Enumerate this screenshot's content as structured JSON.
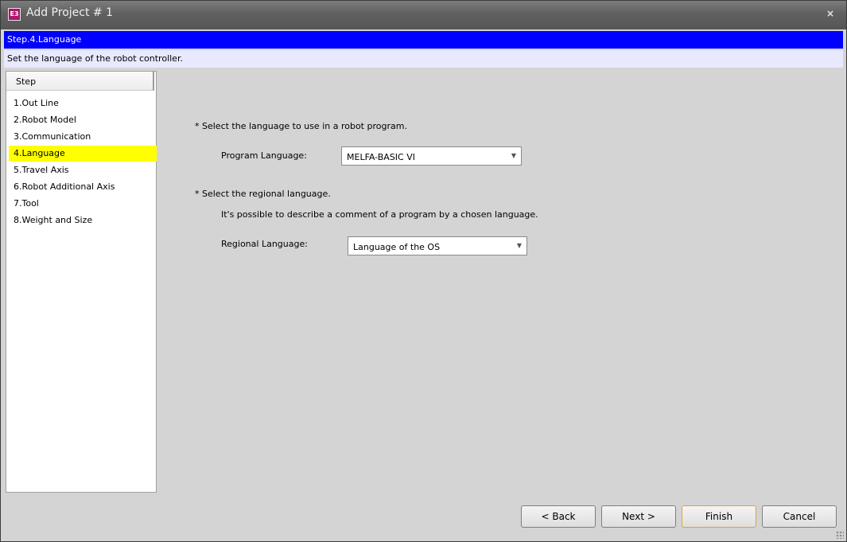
{
  "window": {
    "title": "Add Project # 1",
    "close_glyph": "×",
    "icon_text": "E3"
  },
  "banner": {
    "step_title": "Step.4.Language",
    "description": "Set the language of the robot controller."
  },
  "steps": {
    "header": "Step",
    "items": [
      {
        "label": "1.Out Line"
      },
      {
        "label": "2.Robot Model"
      },
      {
        "label": "3.Communication"
      },
      {
        "label": "4.Language",
        "selected": true
      },
      {
        "label": "5.Travel Axis"
      },
      {
        "label": "6.Robot Additional Axis"
      },
      {
        "label": "7.Tool"
      },
      {
        "label": "8.Weight and Size"
      }
    ]
  },
  "form": {
    "program_hint": "* Select the language to use in a robot program.",
    "program_label": "Program Language:",
    "program_value": "MELFA-BASIC VI",
    "regional_hint": "* Select the regional language.",
    "regional_note": "It's possible to describe a comment of a program by a chosen language.",
    "regional_label": "Regional Language:",
    "regional_value": "Language of the OS"
  },
  "buttons": {
    "back": "< Back",
    "next": "Next >",
    "finish": "Finish",
    "cancel": "Cancel"
  },
  "colors": {
    "banner_bg": "#0000ff",
    "selected_step_bg": "#ffff00",
    "app_icon_bg": "#b0156b"
  }
}
